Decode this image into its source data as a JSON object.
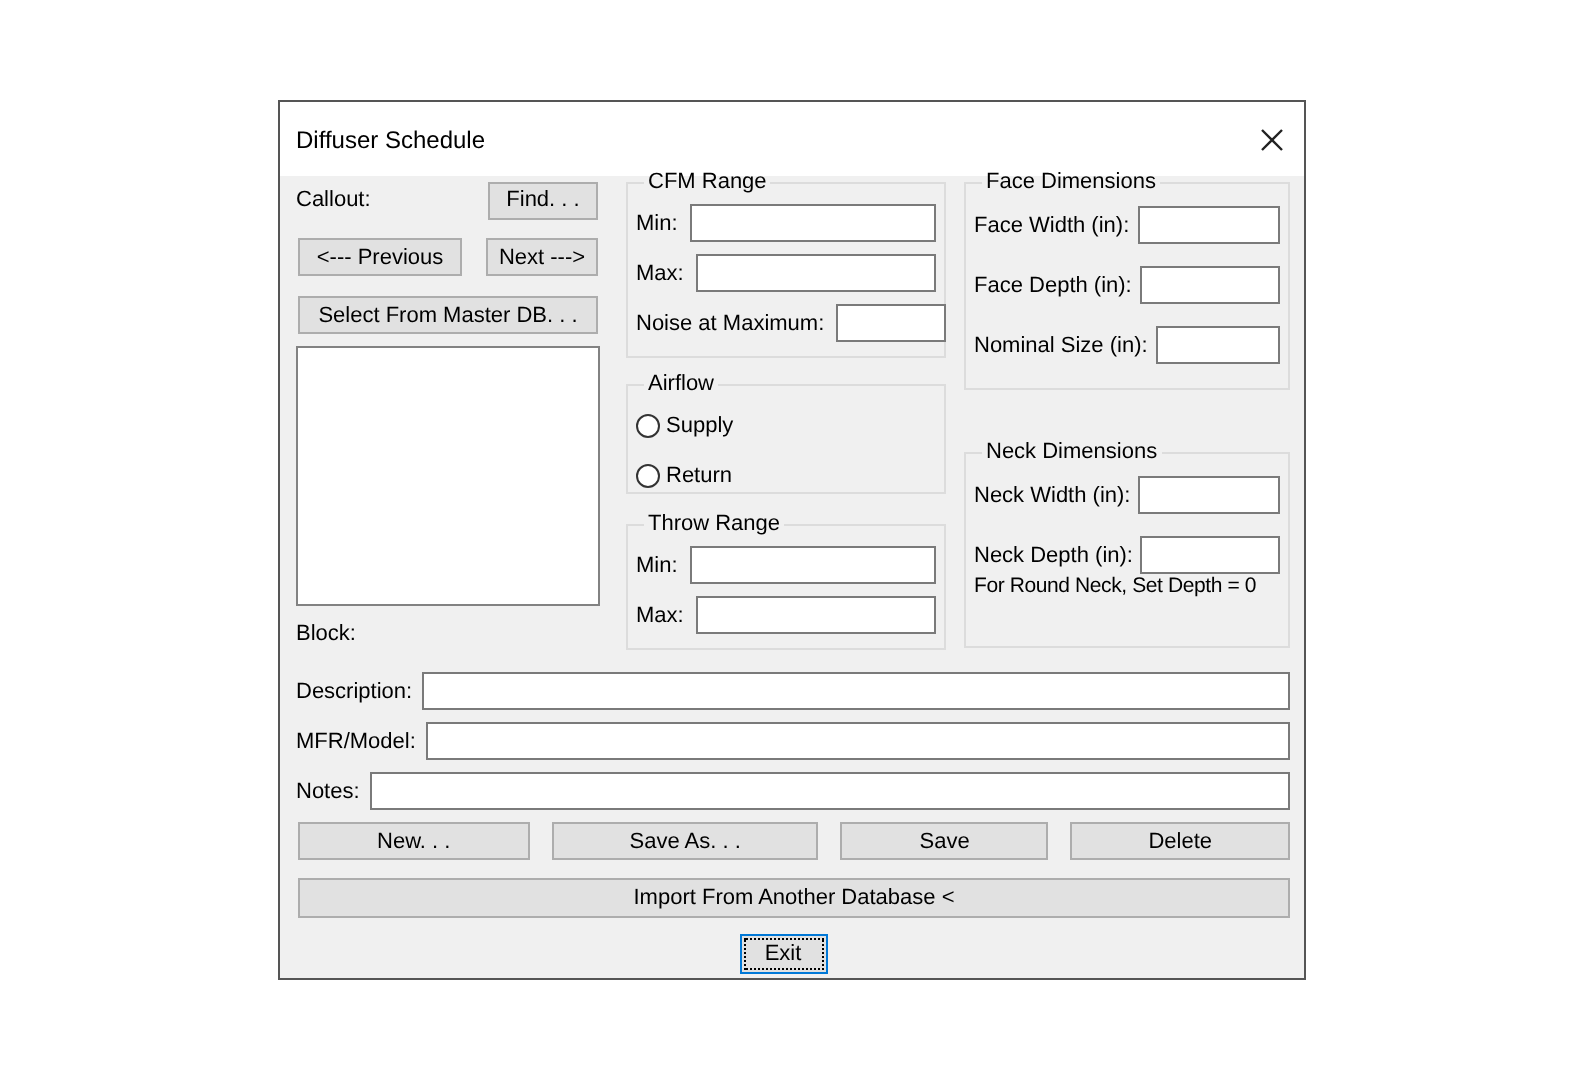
{
  "window": {
    "title": "Diffuser Schedule"
  },
  "left": {
    "callout_label": "Callout:",
    "find_button": "Find. . .",
    "previous_button": "<--- Previous",
    "next_button": "Next --->",
    "select_button": "Select From Master DB. . .",
    "block_label": "Block:"
  },
  "cfm_range": {
    "title": "CFM Range",
    "fields": [
      {
        "label": "Min:"
      },
      {
        "label": "Max:"
      },
      {
        "label": "Noise at Maximum:"
      }
    ]
  },
  "airflow": {
    "title": "Airflow",
    "options": [
      {
        "label": "Supply",
        "selected": false
      },
      {
        "label": "Return",
        "selected": false
      }
    ]
  },
  "throw_range": {
    "title": "Throw Range",
    "fields": [
      {
        "label": "Min:"
      },
      {
        "label": "Max:"
      }
    ]
  },
  "face_dimensions": {
    "title": "Face Dimensions",
    "fields": [
      {
        "label": "Face Width (in):"
      },
      {
        "label": "Face Depth (in):"
      },
      {
        "label": "Nominal Size (in):"
      }
    ]
  },
  "neck_dimensions": {
    "title": "Neck Dimensions",
    "fields": [
      {
        "label": "Neck Width (in):"
      },
      {
        "label": "Neck Depth (in):"
      }
    ],
    "note": "For Round Neck, Set Depth = 0"
  },
  "details": [
    {
      "label": "Description:"
    },
    {
      "label": "MFR/Model:"
    },
    {
      "label": "Notes:"
    }
  ],
  "buttons": [
    "New. . .",
    "Save As. . .",
    "Save",
    "Delete"
  ],
  "import_button": "Import From Another Database <",
  "exit_button": {
    "label": "Exit",
    "focused": true
  }
}
